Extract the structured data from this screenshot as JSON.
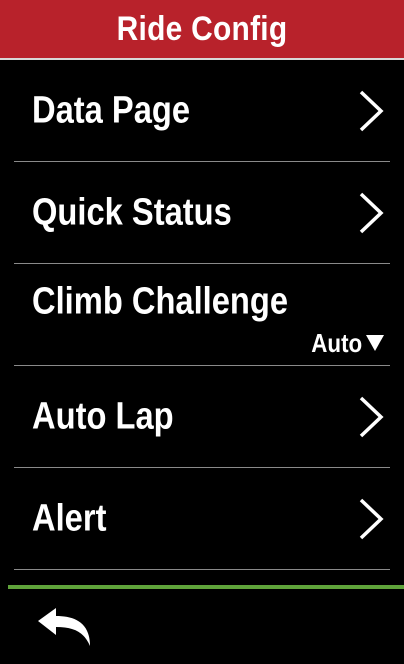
{
  "header": {
    "title": "Ride Config",
    "background_color": "#b8222b"
  },
  "menu": {
    "items": [
      {
        "label": "Data Page",
        "type": "submenu",
        "icon": "chevron-right-icon"
      },
      {
        "label": "Quick Status",
        "type": "submenu",
        "icon": "chevron-right-icon"
      },
      {
        "label": "Climb Challenge",
        "type": "dropdown",
        "value": "Auto",
        "icon": "caret-down-icon"
      },
      {
        "label": "Auto Lap",
        "type": "submenu",
        "icon": "chevron-right-icon"
      },
      {
        "label": "Alert",
        "type": "submenu",
        "icon": "chevron-right-icon"
      }
    ]
  },
  "footer": {
    "back_icon": "back-arrow-icon",
    "accent_color": "#5fa33a"
  }
}
